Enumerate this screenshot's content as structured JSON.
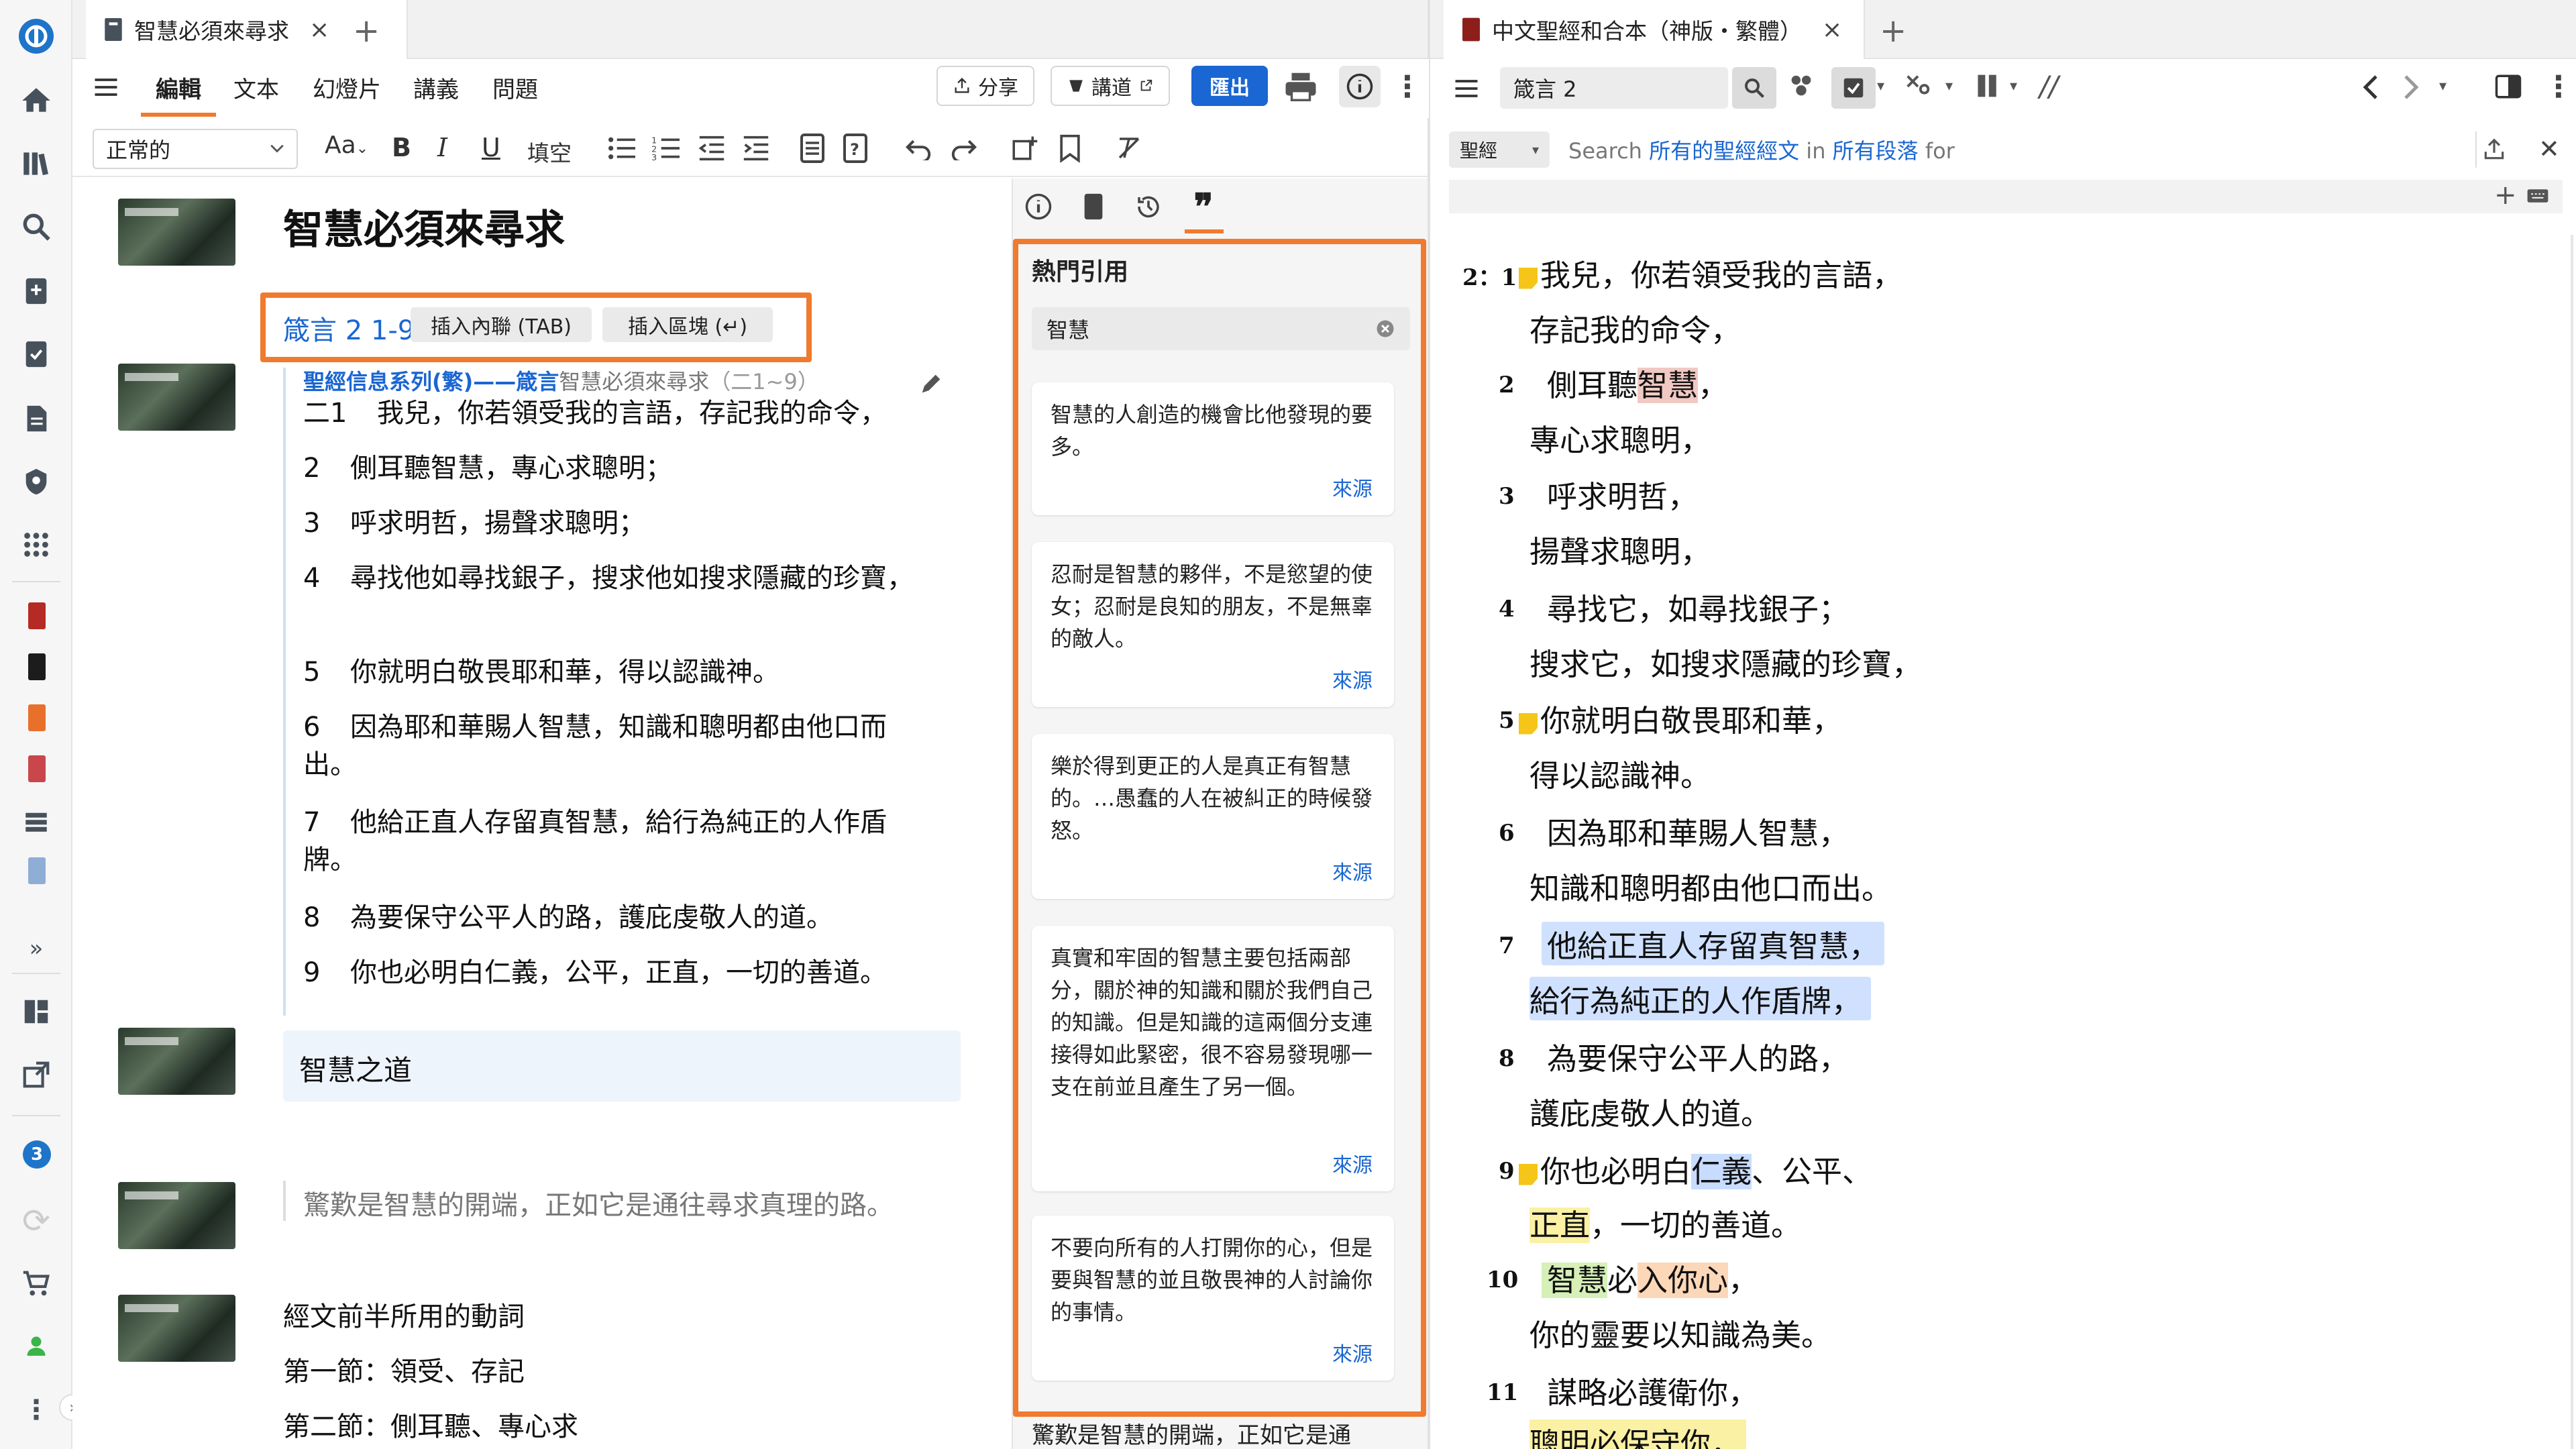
{
  "left_tab": {
    "title": "智慧必須來尋求",
    "close": "×",
    "add": "+"
  },
  "right_tab": {
    "title": "中文聖經和合本（神版・繁體）",
    "close": "×",
    "add": "+"
  },
  "left_toolbar": {
    "menu_tabs": [
      "編輯",
      "文本",
      "幻燈片",
      "講義",
      "問題"
    ],
    "share": "分享",
    "sermon": "講道",
    "export": "匯出",
    "style_select": "正常的",
    "font_size": "Aa",
    "fill_blank": "填空"
  },
  "editor": {
    "title": "智慧必須來尋求",
    "ref_popup": {
      "ref": "箴言 2 1-9",
      "inline": "插入內聯 (TAB)",
      "block": "插入區塊 (↵)"
    },
    "series": {
      "prefix": "聖經信息系列(繁)——箴言",
      "name": "智慧必須來尋求",
      "range": "（二1~9）"
    },
    "verses": [
      {
        "n": "二1",
        "t": "我兒，你若領受我的言語，存記我的命令，"
      },
      {
        "n": "2",
        "t": "側耳聽智慧，專心求聰明；"
      },
      {
        "n": "3",
        "t": "呼求明哲，揚聲求聰明；"
      },
      {
        "n": "4",
        "t": "尋找他如尋找銀子，搜求他如搜求隱藏的珍寶，"
      },
      {
        "n": "5",
        "t": "你就明白敬畏耶和華，得以認識神。"
      },
      {
        "n": "6",
        "t": "因為耶和華賜人智慧，知識和聰明都由他口而出。"
      },
      {
        "n": "7",
        "t": "他給正直人存留真智慧，給行為純正的人作盾牌。"
      },
      {
        "n": "8",
        "t": "為要保守公平人的路，護庇虔敬人的道。"
      },
      {
        "n": "9",
        "t": "你也必明白仁義，公平，正直，一切的善道。"
      }
    ],
    "heading2": "智慧之道",
    "quote_line": "驚歎是智慧的開端，正如它是通往尋求真理的路。",
    "notes": [
      "經文前半所用的動詞",
      "第一節：領受、存記",
      "第二節：側耳聽、專心求"
    ]
  },
  "quotes_panel": {
    "title": "熱門引用",
    "search_value": "智慧",
    "source_label": "來源",
    "quotes": [
      "智慧的人創造的機會比他發現的要多。",
      "忍耐是智慧的夥伴，不是慾望的使女；忍耐是良知的朋友，不是無辜的敵人。",
      "樂於得到更正的人是真正有智慧的。…愚蠢的人在被糾正的時候發怒。",
      "真實和牢固的智慧主要包括兩部分，關於神的知識和關於我們自己的知識。但是知識的這兩個分支連接得如此緊密，很不容易發現哪一支在前並且產生了另一個。",
      "不要向所有的人打開你的心，但是要與智慧的並且敬畏神的人討論你的事情。"
    ],
    "bottom_snippet": "驚歎是智慧的開端，正如它是通"
  },
  "bible_panel": {
    "ref_input": "箴言 2",
    "scope": "聖經",
    "search_text": {
      "a": "Search",
      "b": "所有的聖經經文",
      "c": "in",
      "d": "所有段落",
      "e": "for"
    },
    "chapter_label": "2：1",
    "lines": {
      "v1a": "我兒，你若領受我的言語，",
      "v1b": "存記我的命令，",
      "v2a": "側耳聽",
      "v2b": "智慧",
      "v2c": "，",
      "v2d": "專心求聰明，",
      "v3a": "呼求明哲，",
      "v3b": "揚聲求聰明，",
      "v4a": "尋找它，如尋找銀子；",
      "v4b": "搜求它，如搜求隱藏的珍寶，",
      "v5a": "你就明白敬畏耶和華，",
      "v5b": "得以認識神。",
      "v6a": "因為耶和華賜人智慧，",
      "v6b": "知識和聰明都由他口而出。",
      "v7a": "他給正直人存留真智慧，",
      "v7b": "給行為純正的人作盾牌，",
      "v8a": "為要保守公平人的路，",
      "v8b": "護庇虔敬人的道。",
      "v9a1": "你也必明白",
      "v9a2": "仁義",
      "v9a3": "、公平、",
      "v9b1": "正直",
      "v9b2": "，一切的善道。",
      "v10a1": "智慧",
      "v10a2": "必",
      "v10a3": "入你心",
      "v10a4": "，",
      "v10b": "你的靈要以知識為美。",
      "v11a": "謀略必護衛你，",
      "v11b": "聰明必保守你，"
    },
    "nums": [
      "2",
      "3",
      "4",
      "5",
      "6",
      "7",
      "8",
      "9",
      "10",
      "11"
    ]
  },
  "rail": {
    "badge": "3"
  }
}
